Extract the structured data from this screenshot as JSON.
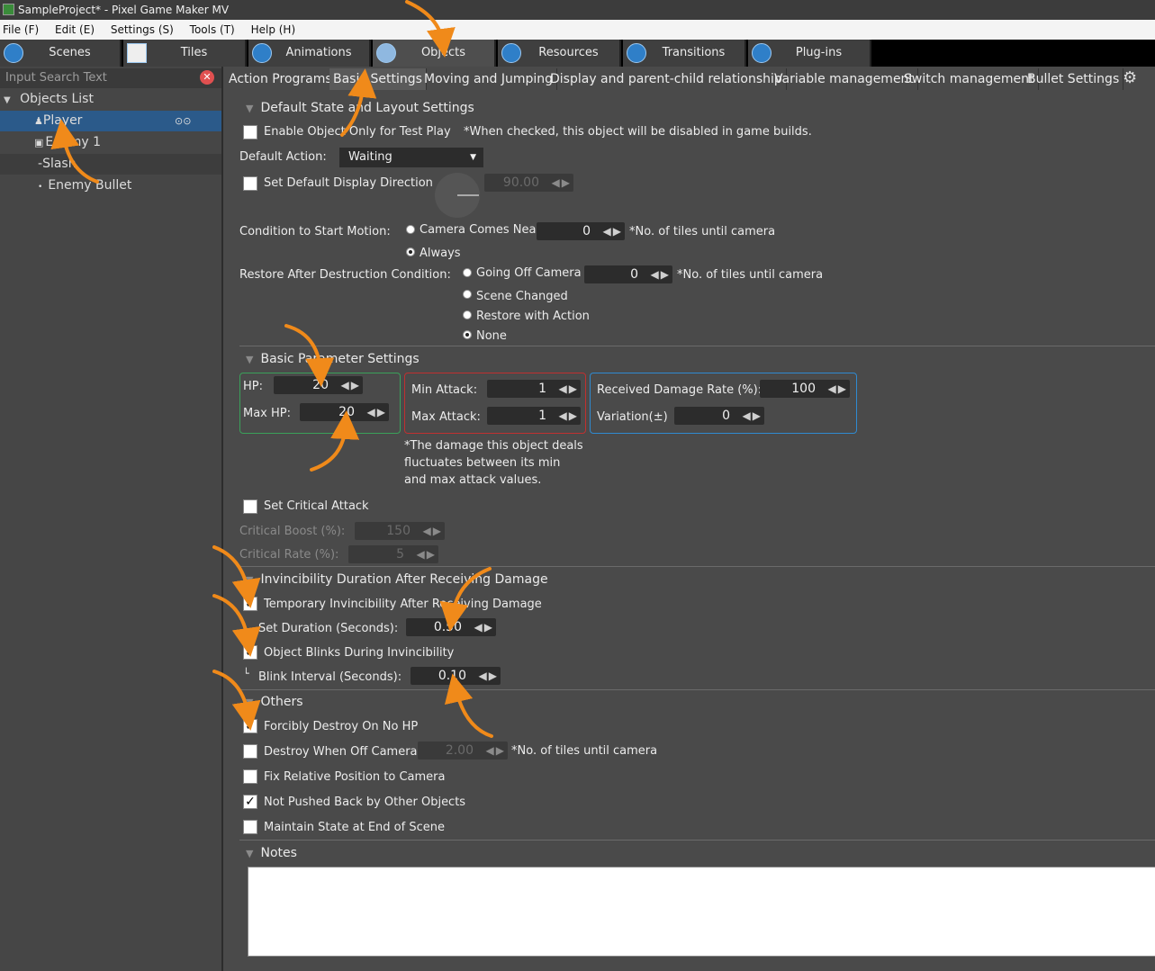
{
  "window": {
    "title": "SampleProject* - Pixel Game Maker MV"
  },
  "menu": [
    "File (F)",
    "Edit (E)",
    "Settings (S)",
    "Tools (T)",
    "Help (H)"
  ],
  "top_tabs": [
    "Scenes",
    "Tiles",
    "Animations",
    "Objects",
    "Resources",
    "Transitions",
    "Plug-ins"
  ],
  "left": {
    "search_placeholder": "Input Search Text",
    "tree_root": "Objects List",
    "items": [
      "Player",
      "Enemy 1",
      "Slash",
      "Enemy Bullet"
    ]
  },
  "sub_tabs": [
    "Action Programs",
    "Basic Settings",
    "Moving and Jumping",
    "Display and parent-child relationship",
    "Variable management",
    "Switch management",
    "Bullet Settings"
  ],
  "default_state": {
    "header": "Default State and Layout Settings",
    "enable_test_play": "Enable Object Only for Test Play",
    "test_play_note": "*When checked, this object will be disabled in game builds.",
    "default_action_label": "Default Action:",
    "default_action_value": "Waiting",
    "set_direction": "Set Default Display Direction",
    "direction_value": "90.00",
    "start_motion_label": "Condition to Start Motion:",
    "camera_near": "Camera Comes Near",
    "camera_near_value": "0",
    "tiles_note": "*No. of tiles until camera",
    "always": "Always",
    "restore_label": "Restore After Destruction Condition:",
    "going_off": "Going Off Camera",
    "going_off_value": "0",
    "scene_changed": "Scene Changed",
    "restore_action": "Restore with Action",
    "none": "None"
  },
  "basic_params": {
    "header": "Basic Parameter Settings",
    "hp_label": "HP:",
    "hp": "20",
    "max_hp_label": "Max HP:",
    "max_hp": "20",
    "min_attack_label": "Min Attack:",
    "min_attack": "1",
    "max_attack_label": "Max Attack:",
    "max_attack": "1",
    "damage_rate_label": "Received Damage Rate (%):",
    "damage_rate": "100",
    "variation_label": "Variation(±)",
    "variation": "0",
    "damage_note_1": "*The damage this object deals",
    "damage_note_2": "fluctuates between its min",
    "damage_note_3": "and max attack values.",
    "critical": "Set Critical Attack",
    "crit_boost_label": "Critical Boost (%):",
    "crit_boost": "150",
    "crit_rate_label": "Critical Rate (%):",
    "crit_rate": "5"
  },
  "invincibility": {
    "header": "Invincibility Duration After Receiving Damage",
    "temp": "Temporary Invincibility After Receiving Damage",
    "duration_label": "Set Duration (Seconds):",
    "duration": "0.50",
    "blinks": "Object Blinks During Invincibility",
    "blink_label": "Blink Interval (Seconds):",
    "blink": "0.10"
  },
  "others": {
    "header": "Others",
    "destroy_no_hp": "Forcibly Destroy On No HP",
    "destroy_off_camera": "Destroy When Off Camera",
    "off_camera_value": "2.00",
    "tiles_note": "*No. of tiles until camera",
    "fix_position": "Fix Relative Position to Camera",
    "not_pushed": "Not Pushed Back by Other Objects",
    "maintain_state": "Maintain State at End of Scene"
  },
  "notes": {
    "header": "Notes"
  },
  "colors": {
    "hp_box": "#3aa05a",
    "attack_box": "#c03030",
    "damage_box": "#2f8ad0",
    "arrow": "#f08a1a",
    "selection": "#2b5a8a"
  }
}
